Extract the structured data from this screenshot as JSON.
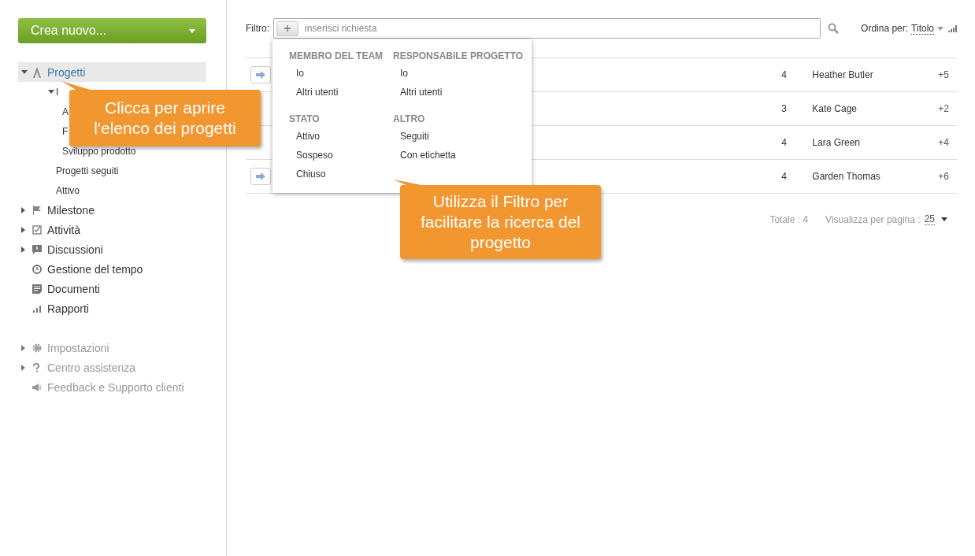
{
  "sidebar": {
    "create_button": "Crea nuovo...",
    "items": [
      {
        "label": "Progetti",
        "expanded": true,
        "selected": true,
        "muted": false,
        "children": [
          {
            "label": "I",
            "expanded": true,
            "children": [
              {
                "label": "A"
              },
              {
                "label": "F"
              },
              {
                "label": "Sviluppo prodotto"
              }
            ]
          },
          {
            "label": "Progetti seguiti"
          },
          {
            "label": "Attivo"
          }
        ]
      },
      {
        "label": "Milestone",
        "expanded": false,
        "selected": false,
        "muted": false
      },
      {
        "label": "Attività",
        "expanded": false,
        "selected": false,
        "muted": false
      },
      {
        "label": "Discussioni",
        "expanded": false,
        "selected": false,
        "muted": false
      },
      {
        "label": "Gestione del tempo",
        "selected": false,
        "muted": false
      },
      {
        "label": "Documenti",
        "selected": false,
        "muted": false
      },
      {
        "label": "Rapporti",
        "selected": false,
        "muted": false
      },
      {
        "label": "Impostazioni",
        "expanded": false,
        "selected": false,
        "muted": true
      },
      {
        "label": "Centro assistenza",
        "expanded": false,
        "selected": false,
        "muted": true
      },
      {
        "label": "Feedback e Supporto clienti",
        "selected": false,
        "muted": true
      }
    ]
  },
  "filter": {
    "label": "Filtro:",
    "placeholder": "inserisci richiesta",
    "sort_label": "Ordina per:",
    "sort_value": "Titolo",
    "menu": [
      {
        "title": "MEMBRO DEL TEAM",
        "options": [
          "Io",
          "Altri utenti"
        ]
      },
      {
        "title": "RESPONSABILE PROGETTO",
        "options": [
          "Io",
          "Altri utenti"
        ]
      },
      {
        "title": "STATO",
        "options": [
          "Attivo",
          "Sospeso",
          "Chiuso"
        ]
      },
      {
        "title": "ALTRO",
        "options": [
          "Seguiti",
          "Con etichetta"
        ]
      }
    ]
  },
  "projects": [
    {
      "button": true,
      "count": "4",
      "manager": "Heather Butler",
      "more": "+5"
    },
    {
      "button": false,
      "count": "3",
      "manager": "Kate Cage",
      "more": "+2"
    },
    {
      "button": false,
      "count": "4",
      "manager": "Lara Green",
      "more": "+4"
    },
    {
      "button": true,
      "count": "4",
      "manager": "Garden Thomas",
      "more": "+6"
    }
  ],
  "footer": {
    "total": "Totale : 4",
    "per_page_label": "Visualizza per pagina :",
    "per_page": "25"
  },
  "callouts": [
    {
      "kind": "sidebar",
      "text": "Clicca per aprire l'elenco dei progetti"
    },
    {
      "kind": "filter",
      "text": "Utilizza il Filtro per facilitare la ricerca del progetto"
    }
  ]
}
